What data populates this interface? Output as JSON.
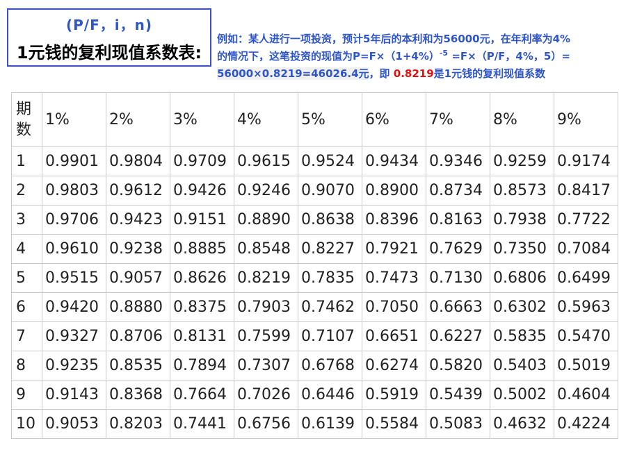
{
  "title": {
    "formula": "(P/F，i，n)",
    "main": "1元钱的复利现值系数表:"
  },
  "example": {
    "line1": "例如：某人进行一项投资，预计5年后的本利和为56000元，在年利率为4%",
    "line2_a": "的情况下，这笔投资的现值为P=F×（1+4%）",
    "line2_exp": "-5",
    "line2_b": " =F×（P/F，4%，5）=",
    "line3_a": "56000×0.8219=46026.4元",
    "line3_b": "，即 ",
    "line3_red": "0.8219",
    "line3_c": "是1元钱的复利现值系数"
  },
  "table": {
    "period_header": [
      "期",
      "数"
    ],
    "rates": [
      "1%",
      "2%",
      "3%",
      "4%",
      "5%",
      "6%",
      "7%",
      "8%",
      "9%"
    ],
    "rows": [
      {
        "n": "1",
        "values": [
          "0.9901",
          "0.9804",
          "0.9709",
          "0.9615",
          "0.9524",
          "0.9434",
          "0.9346",
          "0.9259",
          "0.9174"
        ]
      },
      {
        "n": "2",
        "values": [
          "0.9803",
          "0.9612",
          "0.9426",
          "0.9246",
          "0.9070",
          "0.8900",
          "0.8734",
          "0.8573",
          "0.8417"
        ]
      },
      {
        "n": "3",
        "values": [
          "0.9706",
          "0.9423",
          "0.9151",
          "0.8890",
          "0.8638",
          "0.8396",
          "0.8163",
          "0.7938",
          "0.7722"
        ]
      },
      {
        "n": "4",
        "values": [
          "0.9610",
          "0.9238",
          "0.8885",
          "0.8548",
          "0.8227",
          "0.7921",
          "0.7629",
          "0.7350",
          "0.7084"
        ]
      },
      {
        "n": "5",
        "values": [
          "0.9515",
          "0.9057",
          "0.8626",
          "0.8219",
          "0.7835",
          "0.7473",
          "0.7130",
          "0.6806",
          "0.6499"
        ]
      },
      {
        "n": "6",
        "values": [
          "0.9420",
          "0.8880",
          "0.8375",
          "0.7903",
          "0.7462",
          "0.7050",
          "0.6663",
          "0.6302",
          "0.5963"
        ]
      },
      {
        "n": "7",
        "values": [
          "0.9327",
          "0.8706",
          "0.8131",
          "0.7599",
          "0.7107",
          "0.6651",
          "0.6227",
          "0.5835",
          "0.5470"
        ]
      },
      {
        "n": "8",
        "values": [
          "0.9235",
          "0.8535",
          "0.7894",
          "0.7307",
          "0.6768",
          "0.6274",
          "0.5820",
          "0.5403",
          "0.5019"
        ]
      },
      {
        "n": "9",
        "values": [
          "0.9143",
          "0.8368",
          "0.7664",
          "0.7026",
          "0.6446",
          "0.5919",
          "0.5439",
          "0.5002",
          "0.4604"
        ]
      },
      {
        "n": "10",
        "values": [
          "0.9053",
          "0.8203",
          "0.7441",
          "0.6756",
          "0.6139",
          "0.5584",
          "0.5083",
          "0.4632",
          "0.4224"
        ]
      }
    ]
  },
  "colors": {
    "accent_blue": "#2f56c8",
    "frame_blue": "#3a4fc4",
    "highlight_red": "#e01010",
    "grid": "#c9c9c9"
  }
}
